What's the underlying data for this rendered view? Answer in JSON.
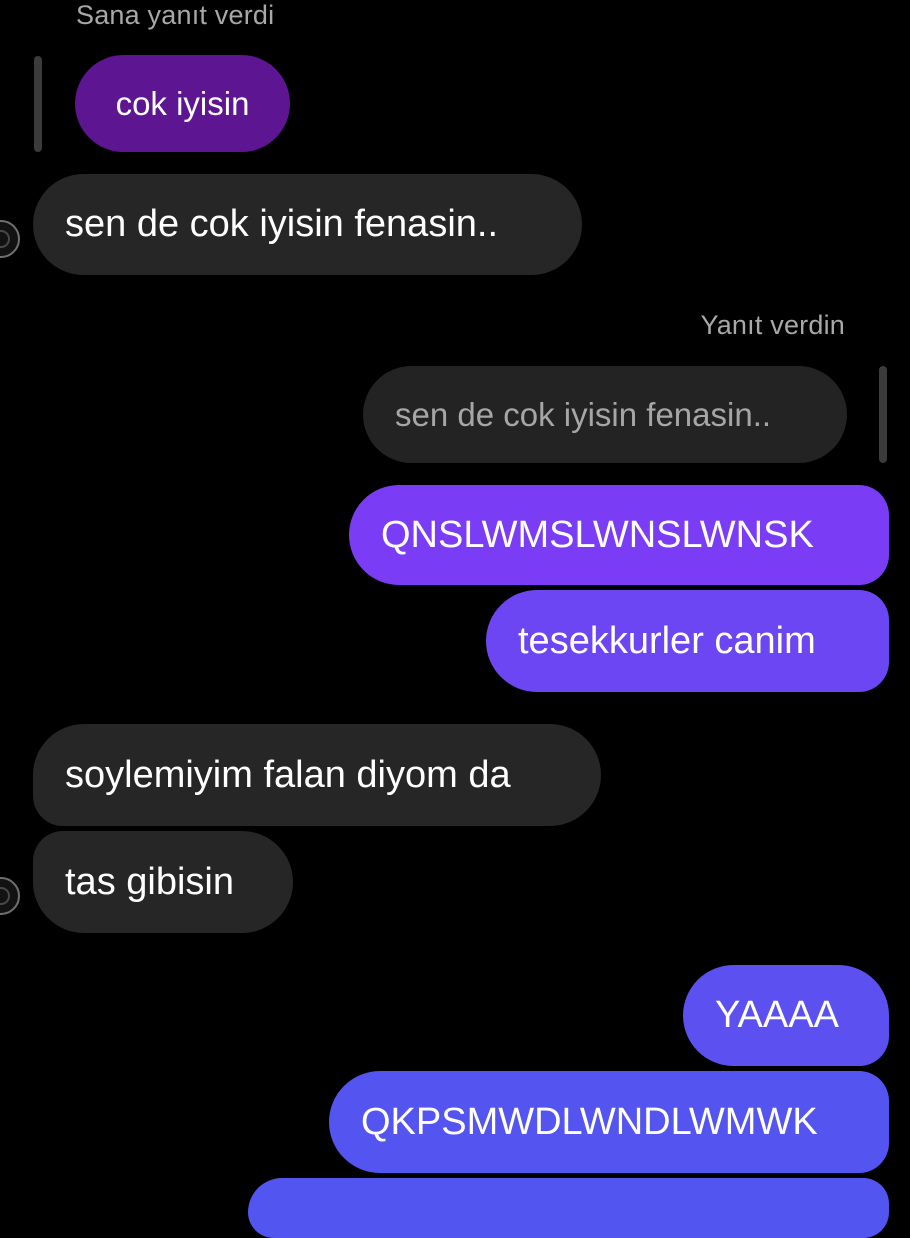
{
  "thread": {
    "reply_label_incoming": "Sana yanıt verdi",
    "reply_label_outgoing": "Yanıt verdin",
    "quoted_incoming_text": "cok iyisin",
    "quoted_outgoing_text": "sen de cok iyisin fenasin..",
    "messages": [
      {
        "direction": "incoming",
        "text": "sen de cok iyisin fenasin.."
      },
      {
        "direction": "outgoing",
        "text": "QNSLWMSLWNSLWNSK"
      },
      {
        "direction": "outgoing",
        "text": "tesekkurler canim"
      },
      {
        "direction": "incoming",
        "text": "soylemiyim falan diyom da"
      },
      {
        "direction": "incoming",
        "text": "tas gibisin"
      },
      {
        "direction": "outgoing",
        "text": "YAAAA"
      },
      {
        "direction": "outgoing",
        "text": "QKPSMWDLWNDLWMWK"
      }
    ]
  },
  "colors": {
    "background": "#000000",
    "incoming_bubble": "#262626",
    "quoted_incoming_bubble": "#5e1591",
    "quoted_outgoing_bubble": "#232323",
    "outgoing_gradient_top": "#7a3cf5",
    "outgoing_gradient_bottom": "#5355f0"
  }
}
